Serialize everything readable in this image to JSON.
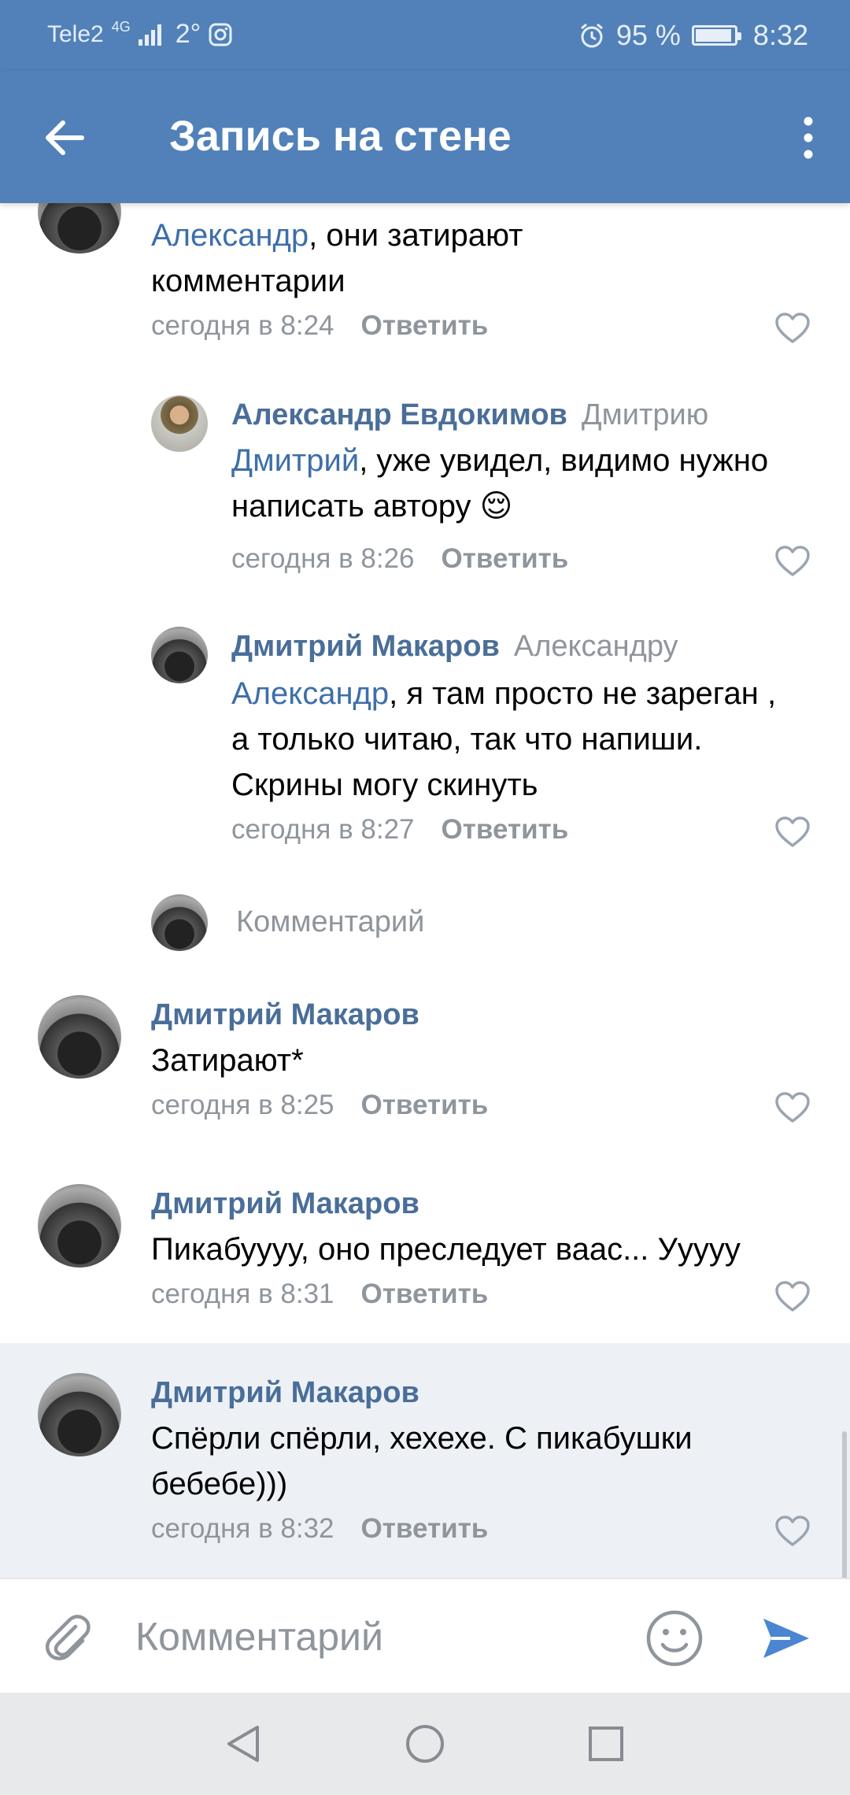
{
  "status_bar": {
    "carrier": "Tele2",
    "network": "4G",
    "temperature": "2°",
    "battery_percent": "95 %",
    "battery_level": 0.95,
    "time": "8:32"
  },
  "app_bar": {
    "title": "Запись на стене"
  },
  "comments": [
    {
      "name_partial": "",
      "mention": "Александр",
      "text": ", они затирают комментарии",
      "time": "сегодня в 8:24",
      "reply": "Ответить"
    },
    {
      "name": "Александр Евдокимов",
      "reply_to": "Дмитрию",
      "mention": "Дмитрий",
      "text": ", уже увидел, видимо нужно написать автору 😌",
      "time": "сегодня в 8:26",
      "reply": "Ответить"
    },
    {
      "name": "Дмитрий Макаров",
      "reply_to": "Александру",
      "mention": "Александр",
      "text": ", я там просто не зареган , а только читаю, так что напиши. Скрины могу скинуть",
      "time": "сегодня в 8:27",
      "reply": "Ответить"
    },
    {
      "name": "Дмитрий Макаров",
      "text": "Затирают*",
      "time": "сегодня в 8:25",
      "reply": "Ответить"
    },
    {
      "name": "Дмитрий Макаров",
      "text": "Пикабуууу, оно преследует ваас... Ууууу",
      "time": "сегодня в 8:31",
      "reply": "Ответить"
    },
    {
      "name": "Дмитрий Макаров",
      "text": "Спёрли спёрли, хехехе. С пикабушки бебебе)))",
      "time": "сегодня в 8:32",
      "reply": "Ответить"
    }
  ],
  "thread_reply_placeholder": "Комментарий",
  "compose": {
    "placeholder": "Комментарий"
  },
  "colors": {
    "header": "#5181b8",
    "name": "#4a6e99",
    "mention": "#3d6fa8",
    "meta": "#8f959c",
    "highlight": "#edf1f6"
  }
}
